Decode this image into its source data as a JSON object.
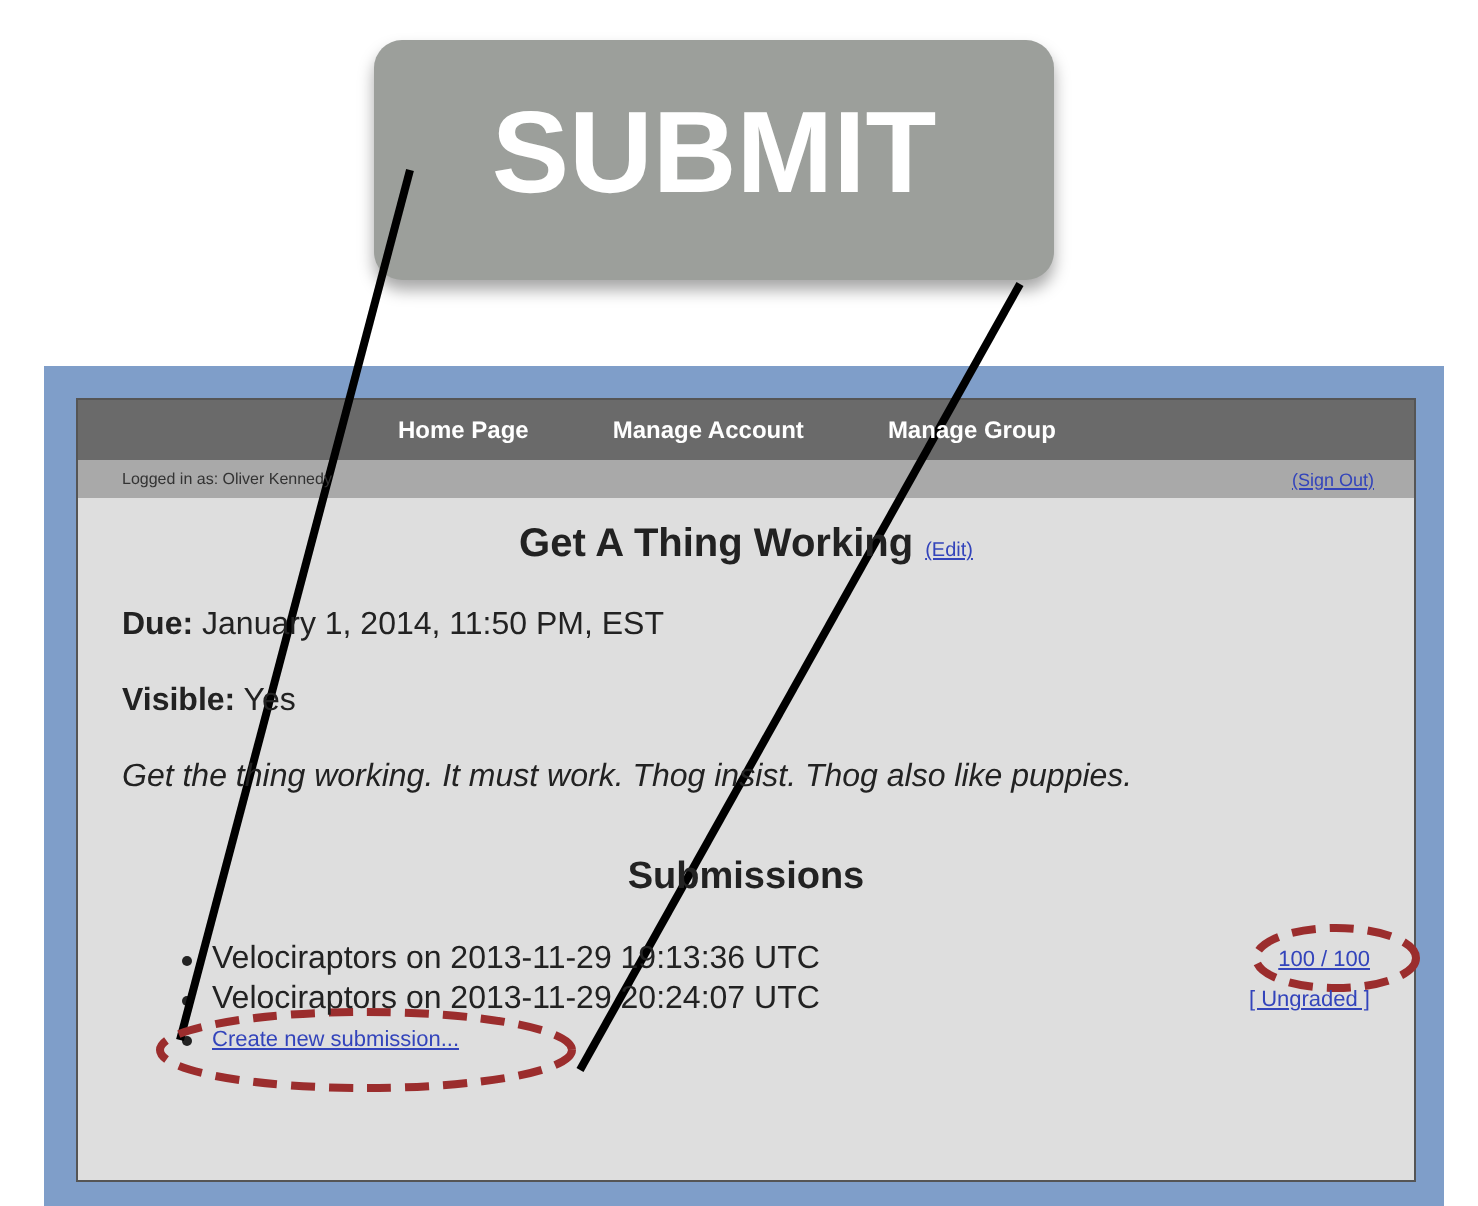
{
  "callout": {
    "text": "SUBMIT"
  },
  "nav": {
    "items": [
      {
        "label": "Home Page"
      },
      {
        "label": "Manage Account"
      },
      {
        "label": "Manage Group"
      }
    ]
  },
  "user_bar": {
    "logged_in": "Logged in as: Oliver Kennedy",
    "sign_out": "(Sign Out)"
  },
  "assignment": {
    "title": "Get A Thing Working",
    "edit": "(Edit)",
    "due_label": "Due:",
    "due": "January 1, 2014, 11:50 PM, EST",
    "visible_label": "Visible:",
    "visible": "Yes",
    "description": "Get the thing working. It must work. Thog insist. Thog also like puppies."
  },
  "submissions": {
    "heading": "Submissions",
    "items": [
      {
        "text": "Velociraptors on 2013-11-29 19:13:36 UTC",
        "grade": "100 / 100"
      },
      {
        "text": "Velociraptors on 2013-11-29 20:24:07 UTC",
        "grade": "[ Ungraded ]"
      }
    ],
    "create_link": "Create new submission..."
  }
}
